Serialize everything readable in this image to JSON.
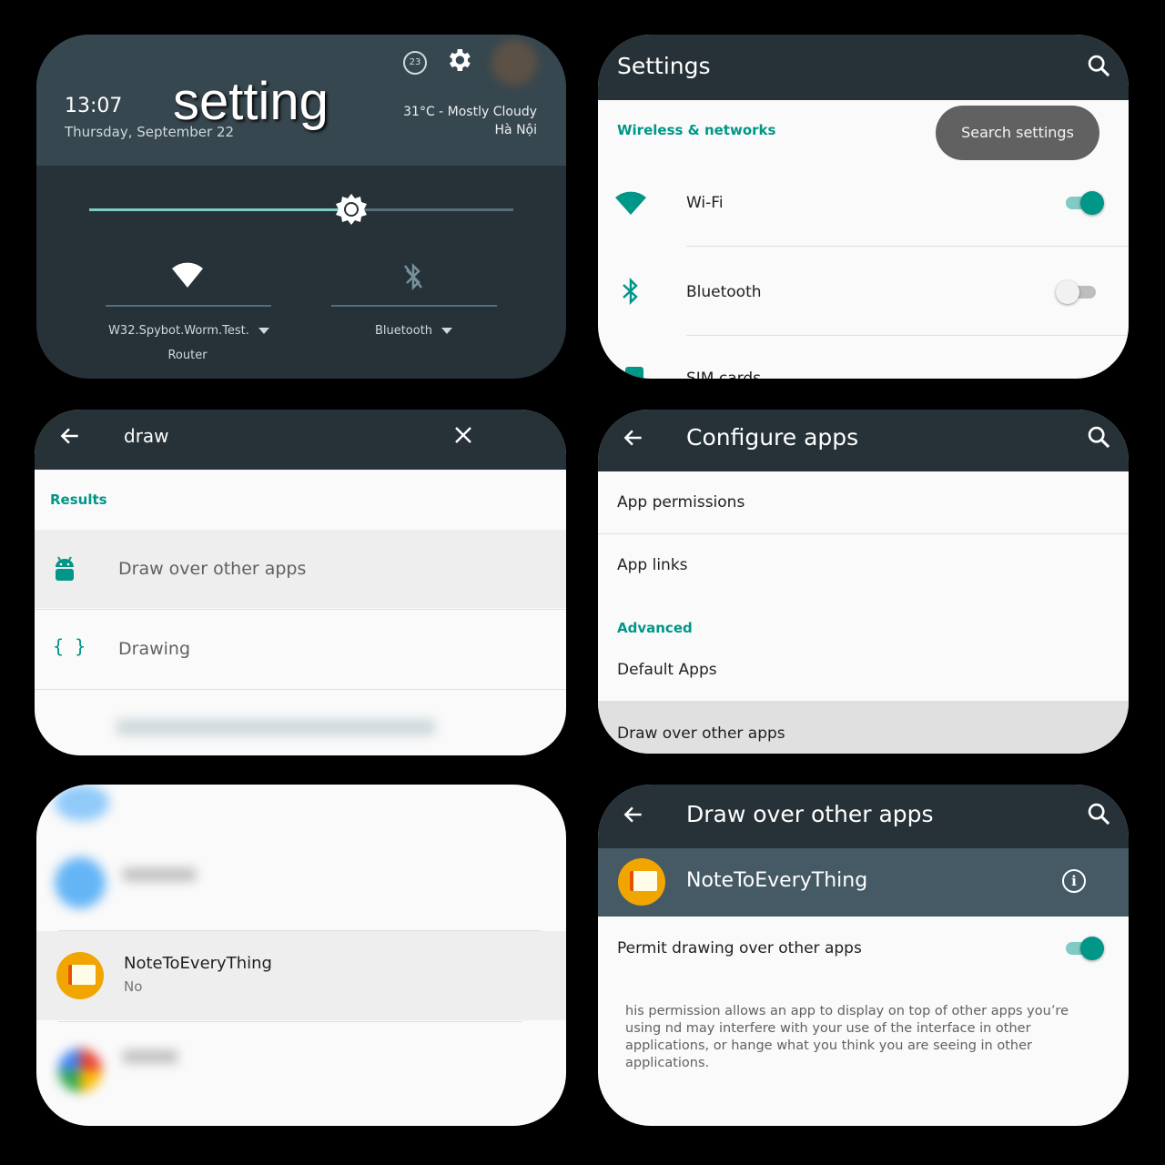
{
  "quick_settings": {
    "overlay_title": "setting",
    "time": "13:07",
    "date": "Thursday, September 22",
    "weather": "31°C - Mostly Cloudy",
    "location": "Hà Nội",
    "badge_number": "23",
    "wifi_label": "W32.Spybot.Worm.Test.",
    "wifi_sub": "Router",
    "bluetooth_label": "Bluetooth",
    "brightness_level": 0.62,
    "accent_color": "#80cbc4"
  },
  "settings": {
    "title": "Settings",
    "section": "Wireless & networks",
    "search_toast": "Search settings",
    "items": [
      {
        "label": "Wi-Fi",
        "on": true,
        "icon": "wifi-icon"
      },
      {
        "label": "Bluetooth",
        "on": false,
        "icon": "bluetooth-icon"
      },
      {
        "label": "SIM cards",
        "icon": "sim-card-icon"
      }
    ]
  },
  "search": {
    "query": "draw",
    "results_header": "Results",
    "results": [
      {
        "label": "Draw over other apps",
        "icon": "android-icon"
      },
      {
        "label": "Drawing",
        "icon": "braces-icon"
      }
    ]
  },
  "configure": {
    "title": "Configure apps",
    "items": [
      "App permissions",
      "App links"
    ],
    "advanced_header": "Advanced",
    "advanced_items": [
      "Default Apps",
      "Draw over other apps"
    ]
  },
  "app_list": {
    "app_name": "NoteToEveryThing",
    "app_status": "No"
  },
  "draw_over": {
    "title": "Draw over other apps",
    "app_name": "NoteToEveryThing",
    "permit_label": "Permit drawing over other apps",
    "permit_on": true,
    "description": "his permission allows an app to display on top of other apps you’re using nd may interfere with your use of the interface in other applications, or hange what you think you are seeing in other applications."
  },
  "colors": {
    "appbar": "#263238",
    "accent": "#009688",
    "toggle_on_track": "#80cbc4"
  }
}
